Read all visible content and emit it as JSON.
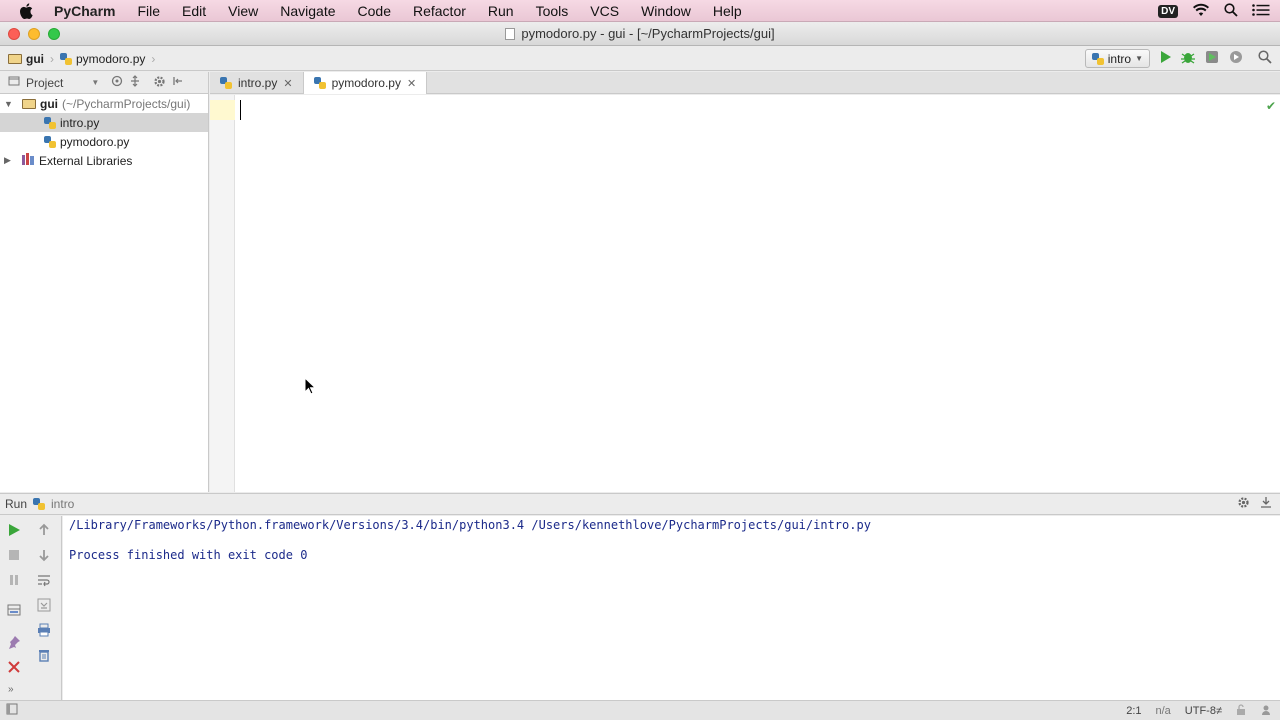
{
  "menubar": {
    "app_name": "PyCharm",
    "items": [
      "File",
      "Edit",
      "View",
      "Navigate",
      "Code",
      "Refactor",
      "Run",
      "Tools",
      "VCS",
      "Window",
      "Help"
    ],
    "right_badge": "DV"
  },
  "window": {
    "title": "pymodoro.py - gui - [~/PycharmProjects/gui]"
  },
  "navbar": {
    "crumbs": [
      "gui",
      "pymodoro.py"
    ],
    "run_config": "intro"
  },
  "project": {
    "header_label": "Project",
    "root_name": "gui",
    "root_path": "(~/PycharmProjects/gui)",
    "files": [
      "intro.py",
      "pymodoro.py"
    ],
    "external": "External Libraries"
  },
  "editor": {
    "tabs": [
      "intro.py",
      "pymodoro.py"
    ],
    "active_tab": "pymodoro.py"
  },
  "run": {
    "label": "Run",
    "config": "intro",
    "console_lines": [
      "/Library/Frameworks/Python.framework/Versions/3.4/bin/python3.4 /Users/kennethlove/PycharmProjects/gui/intro.py",
      "",
      "Process finished with exit code 0"
    ]
  },
  "status": {
    "position": "2:1",
    "na": "n/a",
    "encoding": "UTF-8≠"
  },
  "colors": {
    "menubar_bg": "#f6d9e4",
    "run_green": "#3aa63a",
    "console_text": "#1b2a8a"
  }
}
